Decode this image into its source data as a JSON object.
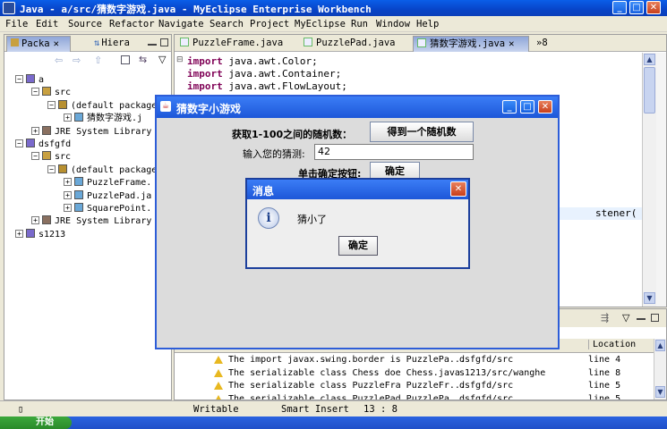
{
  "window": {
    "title": "Java - a/src/猜数字游戏.java - MyEclipse Enterprise Workbench",
    "min_glyph": "_",
    "max_glyph": "□",
    "close_glyph": "✕"
  },
  "menu": [
    "File",
    "Edit",
    "Source",
    "Refactor",
    "Navigate",
    "Search",
    "Project",
    "MyEclipse",
    "Run",
    "Window",
    "Help"
  ],
  "left_panel": {
    "tabs": [
      "Packa",
      "Hiera"
    ],
    "tree": [
      {
        "label": "a",
        "indent": 0,
        "expander": "−",
        "icon": "project-icon"
      },
      {
        "label": "src",
        "indent": 1,
        "expander": "−",
        "icon": "source-folder-icon"
      },
      {
        "label": "(default package",
        "indent": 2,
        "expander": "−",
        "icon": "package-icon"
      },
      {
        "label": "猜数字游戏.j",
        "indent": 3,
        "expander": "+",
        "icon": "java-file-icon"
      },
      {
        "label": "JRE System Library",
        "indent": 1,
        "expander": "+",
        "icon": "library-icon"
      },
      {
        "label": "dsfgfd",
        "indent": 0,
        "expander": "−",
        "icon": "project-icon"
      },
      {
        "label": "src",
        "indent": 1,
        "expander": "−",
        "icon": "source-folder-icon"
      },
      {
        "label": "(default package",
        "indent": 2,
        "expander": "−",
        "icon": "package-icon"
      },
      {
        "label": "PuzzleFrame.",
        "indent": 3,
        "expander": "+",
        "icon": "java-file-icon"
      },
      {
        "label": "PuzzlePad.ja",
        "indent": 3,
        "expander": "+",
        "icon": "java-file-icon"
      },
      {
        "label": "SquarePoint.",
        "indent": 3,
        "expander": "+",
        "icon": "java-file-icon"
      },
      {
        "label": "JRE System Library",
        "indent": 1,
        "expander": "+",
        "icon": "library-icon"
      },
      {
        "label": "s1213",
        "indent": 0,
        "expander": "+",
        "icon": "project-icon"
      }
    ]
  },
  "editor": {
    "tabs": [
      "PuzzleFrame.java",
      "PuzzlePad.java",
      "猜数字游戏.java"
    ],
    "overflow_label": "»8",
    "code": [
      {
        "kw": "import",
        "rest": " java.awt.Color;"
      },
      {
        "kw": "import",
        "rest": " java.awt.Container;"
      },
      {
        "kw": "import",
        "rest": " java.awt.FlowLayout;"
      }
    ],
    "partial_line": "stener("
  },
  "bottom_panel": {
    "location_header": "Location",
    "rows": [
      {
        "desc": "The import javax.swing.border is PuzzlePa...",
        "path": "dsfgfd/src",
        "loc": "line 4"
      },
      {
        "desc": "The serializable class Chess doe Chess.java",
        "path": "s1213/src/wanghe",
        "loc": "line 8"
      },
      {
        "desc": "The serializable class PuzzleFra PuzzleFr...",
        "path": "dsfgfd/src",
        "loc": "line 5"
      },
      {
        "desc": "The serializable class PuzzlePad PuzzlePa...",
        "path": "dsfgfd/src",
        "loc": "line 5"
      }
    ]
  },
  "status": {
    "writable": "Writable",
    "insert": "Smart Insert",
    "position": "13 : 8"
  },
  "taskbar": {
    "start_label": "开始"
  },
  "swing": {
    "title": "猜数字小游戏",
    "label_random": "获取1-100之间的随机数：",
    "button_random": "得到一个随机数",
    "label_guess": "输入您的猜测:",
    "guess_value": "42",
    "label_confirm": "单击确定按钮:",
    "button_confirm": "确定"
  },
  "message": {
    "title": "消息",
    "text": "猜小了",
    "ok": "确定",
    "info_glyph": "i"
  }
}
